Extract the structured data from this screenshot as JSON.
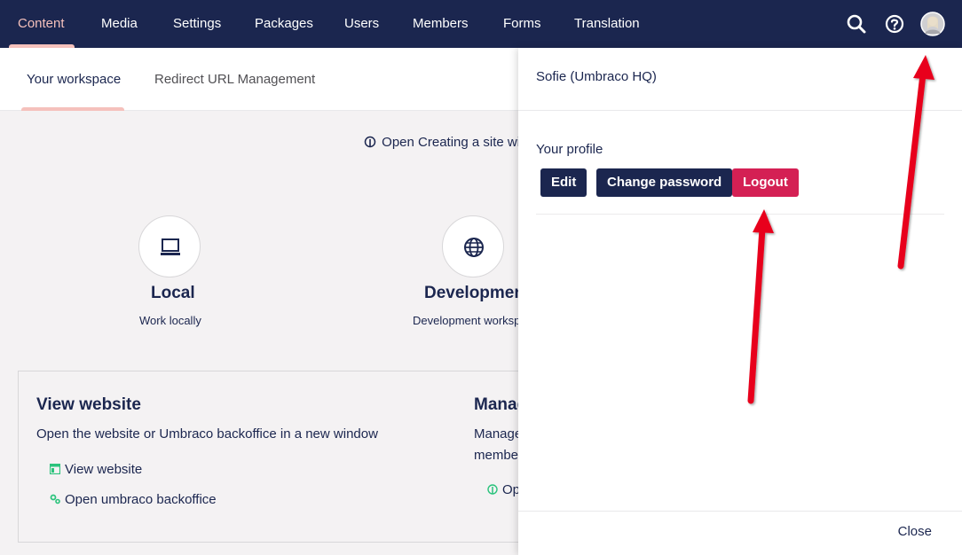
{
  "nav": {
    "items": [
      {
        "label": "Content",
        "active": true
      },
      {
        "label": "Media"
      },
      {
        "label": "Settings"
      },
      {
        "label": "Packages"
      },
      {
        "label": "Users"
      },
      {
        "label": "Members"
      },
      {
        "label": "Forms"
      },
      {
        "label": "Translation"
      }
    ],
    "icons": [
      "search-icon",
      "help-icon",
      "user-avatar"
    ]
  },
  "tabs": [
    {
      "label": "Your workspace",
      "active": true
    },
    {
      "label": "Redirect URL Management"
    }
  ],
  "dashboard": {
    "open_link": "Open Creating a site wi",
    "environments": [
      {
        "title": "Local",
        "subtitle": "Work locally",
        "icon": "laptop-icon"
      },
      {
        "title": "Development",
        "subtitle": "Development worksp",
        "icon": "globe-icon"
      }
    ],
    "view_box": {
      "title": "View website",
      "text": "Open the website or Umbraco backoffice in a new window",
      "links": [
        {
          "label": "View website",
          "icon": "website-icon"
        },
        {
          "label": "Open umbraco backoffice",
          "icon": "cogs-icon"
        }
      ]
    },
    "manage_box": {
      "title": "Manag",
      "text_line1": "Manage",
      "text_line2": "member",
      "link": "Op"
    }
  },
  "user_panel": {
    "name": "Sofie (Umbraco HQ)",
    "section_label": "Your profile",
    "buttons": {
      "edit": "Edit",
      "change_password": "Change password",
      "logout": "Logout"
    },
    "close_label": "Close"
  },
  "colors": {
    "nav_bg": "#1b264f",
    "accent": "#f5c1bc",
    "danger": "#d42054",
    "arrow": "#e8001c"
  }
}
